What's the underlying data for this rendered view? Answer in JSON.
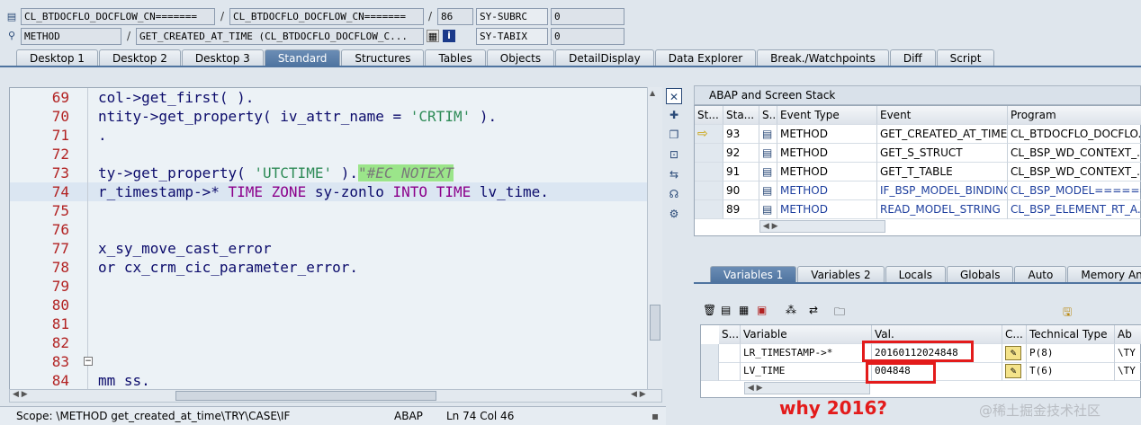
{
  "header": {
    "row1": {
      "class_name": "CL_BTDOCFLO_DOCFLOW_CN=======",
      "class_name2": "CL_BTDOCFLO_DOCFLOW_CN=======",
      "line": "86",
      "sy_label": "SY-SUBRC",
      "sy_value": "0"
    },
    "row2": {
      "type": "METHOD",
      "method": "GET_CREATED_AT_TIME (CL_BTDOCFLO_DOCFLOW_C...",
      "sy_label": "SY-TABIX",
      "sy_value": "0"
    },
    "separator": "/"
  },
  "tabs": [
    "Desktop 1",
    "Desktop 2",
    "Desktop 3",
    "Standard",
    "Structures",
    "Tables",
    "Objects",
    "DetailDisplay",
    "Data Explorer",
    "Break./Watchpoints",
    "Diff",
    "Script"
  ],
  "editor": {
    "lines": [
      {
        "num": "69",
        "parts": [
          [
            "n",
            "col->get_first( )."
          ]
        ]
      },
      {
        "num": "70",
        "parts": [
          [
            "n",
            "ntity->get_property( iv_attr_name = "
          ],
          [
            "s",
            "'CRTIM'"
          ],
          [
            "n",
            " )."
          ]
        ]
      },
      {
        "num": "71",
        "parts": [
          [
            "n",
            "."
          ]
        ]
      },
      {
        "num": "72",
        "parts": []
      },
      {
        "num": "73",
        "parts": [
          [
            "n",
            "ty->get_property( "
          ],
          [
            "s",
            "'UTCTIME'"
          ],
          [
            "n",
            " )."
          ],
          [
            "c",
            "\"#EC NOTEXT"
          ]
        ]
      },
      {
        "num": "74",
        "parts": [
          [
            "n",
            "r_timestamp->* "
          ],
          [
            "k",
            "TIME ZONE"
          ],
          [
            "n",
            " sy-zonlo "
          ],
          [
            "k",
            "INTO TIME"
          ],
          [
            "n",
            " lv_time."
          ]
        ]
      },
      {
        "num": "75",
        "parts": []
      },
      {
        "num": "76",
        "parts": []
      },
      {
        "num": "77",
        "parts": [
          [
            "n",
            "x_sy_move_cast_error"
          ]
        ]
      },
      {
        "num": "78",
        "parts": [
          [
            "n",
            "or cx_crm_cic_parameter_error."
          ]
        ]
      },
      {
        "num": "79",
        "parts": []
      },
      {
        "num": "80",
        "parts": []
      },
      {
        "num": "81",
        "parts": []
      },
      {
        "num": "82",
        "parts": []
      },
      {
        "num": "83",
        "parts": []
      },
      {
        "num": "84",
        "parts": [
          [
            "n",
            "mm ss."
          ]
        ]
      }
    ],
    "current_line_index": 5
  },
  "status_bar": {
    "scope": "Scope: \\METHOD get_created_at_time\\TRY\\CASE\\IF",
    "language": "ABAP",
    "position": "Ln  74 Col  46"
  },
  "stack": {
    "title": "ABAP and Screen Stack",
    "columns": [
      "St...",
      "Sta...",
      "S...",
      "Event Type",
      "Event",
      "Program"
    ],
    "rows": [
      {
        "marker": "⇨",
        "level": "93",
        "event_type": "METHOD",
        "event": "GET_CREATED_AT_TIME",
        "program": "CL_BTDOCFLO_DOCFLO..."
      },
      {
        "marker": "",
        "level": "92",
        "event_type": "METHOD",
        "event": "GET_S_STRUCT",
        "program": "CL_BSP_WD_CONTEXT_..."
      },
      {
        "marker": "",
        "level": "91",
        "event_type": "METHOD",
        "event": "GET_T_TABLE",
        "program": "CL_BSP_WD_CONTEXT_..."
      },
      {
        "marker": "",
        "level": "90",
        "event_type": "METHOD",
        "event": "IF_BSP_MODEL_BINDING...",
        "program": "CL_BSP_MODEL======..."
      },
      {
        "marker": "",
        "level": "89",
        "event_type": "METHOD",
        "event": "READ_MODEL_STRING",
        "program": "CL_BSP_ELEMENT_RT_A..."
      }
    ]
  },
  "var_tabs": [
    "Variables 1",
    "Variables 2",
    "Locals",
    "Globals",
    "Auto",
    "Memory Analysis"
  ],
  "variables": {
    "columns": [
      "S...",
      "Variable",
      "Val.",
      "C...",
      "Technical Type",
      "Ab"
    ],
    "rows": [
      {
        "name": "LR_TIMESTAMP->*",
        "value": "20160112024848",
        "tech_type": "P(8)",
        "ab": "\\TY"
      },
      {
        "name": "LV_TIME",
        "value": "004848",
        "tech_type": "T(6)",
        "ab": "\\TY"
      }
    ]
  },
  "annotation": {
    "question": "why 2016?"
  },
  "watermark": "@稀土掘金技术社区"
}
